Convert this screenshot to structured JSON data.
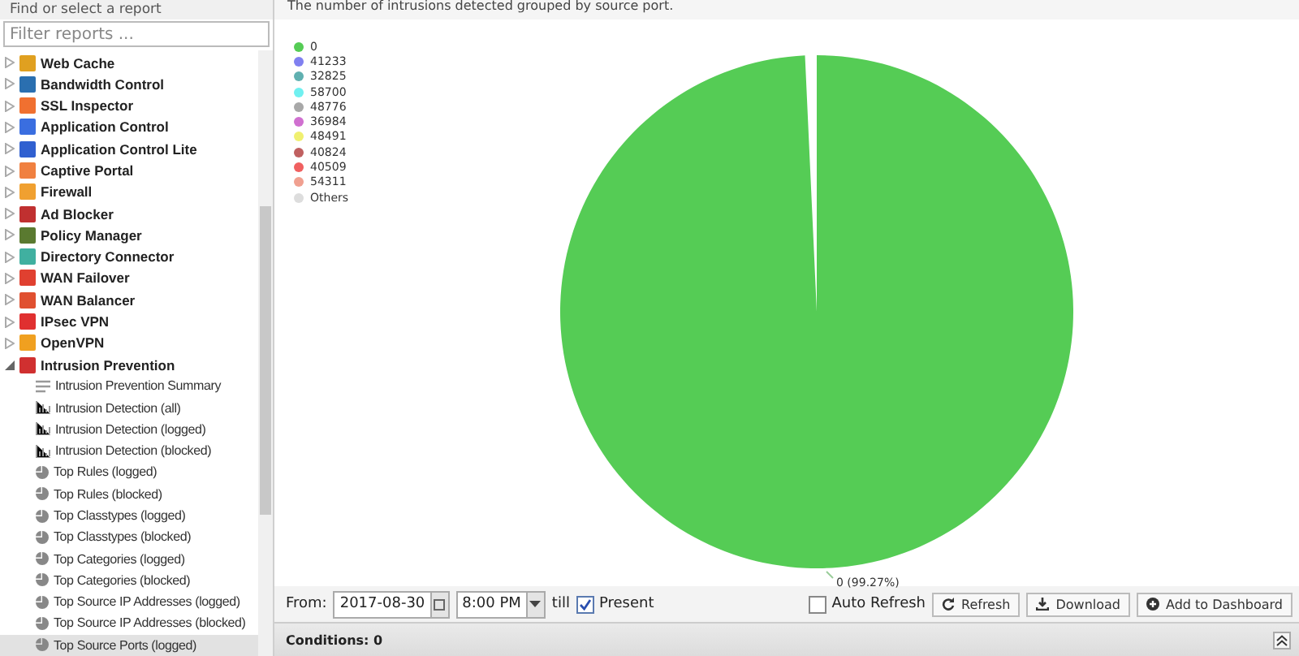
{
  "sidebar": {
    "title": "Find or select a report",
    "filter": {
      "placeholder": "Filter reports ..."
    },
    "items": [
      {
        "label": "Web Cache",
        "color": "#e0a020",
        "expanded": false,
        "selected": false
      },
      {
        "label": "Bandwidth Control",
        "color": "#2a6fb0",
        "expanded": false,
        "selected": false
      },
      {
        "label": "SSL Inspector",
        "color": "#f07030",
        "expanded": false,
        "selected": false
      },
      {
        "label": "Application Control",
        "color": "#3a6ee0",
        "expanded": false,
        "selected": false
      },
      {
        "label": "Application Control Lite",
        "color": "#3060d0",
        "expanded": false,
        "selected": false
      },
      {
        "label": "Captive Portal",
        "color": "#f08040",
        "expanded": false,
        "selected": false
      },
      {
        "label": "Firewall",
        "color": "#f0a030",
        "expanded": false,
        "selected": false
      },
      {
        "label": "Ad Blocker",
        "color": "#c03030",
        "expanded": false,
        "selected": false
      },
      {
        "label": "Policy Manager",
        "color": "#5a7a30",
        "expanded": false,
        "selected": false
      },
      {
        "label": "Directory Connector",
        "color": "#40b0a0",
        "expanded": false,
        "selected": false
      },
      {
        "label": "WAN Failover",
        "color": "#e04030",
        "expanded": false,
        "selected": false
      },
      {
        "label": "WAN Balancer",
        "color": "#e05030",
        "expanded": false,
        "selected": false
      },
      {
        "label": "IPsec VPN",
        "color": "#e03030",
        "expanded": false,
        "selected": false
      },
      {
        "label": "OpenVPN",
        "color": "#f0a020",
        "expanded": false,
        "selected": false
      },
      {
        "label": "Intrusion Prevention",
        "color": "#d03030",
        "expanded": true,
        "selected": false,
        "children": [
          {
            "label": "Intrusion Prevention Summary",
            "kind": "summary",
            "selected": false
          },
          {
            "label": "Intrusion Detection (all)",
            "kind": "timeseries",
            "selected": false
          },
          {
            "label": "Intrusion Detection (logged)",
            "kind": "timeseries",
            "selected": false
          },
          {
            "label": "Intrusion Detection (blocked)",
            "kind": "timeseries",
            "selected": false
          },
          {
            "label": "Top Rules (logged)",
            "kind": "pie",
            "selected": false
          },
          {
            "label": "Top Rules (blocked)",
            "kind": "pie",
            "selected": false
          },
          {
            "label": "Top Classtypes (logged)",
            "kind": "pie",
            "selected": false
          },
          {
            "label": "Top Classtypes (blocked)",
            "kind": "pie",
            "selected": false
          },
          {
            "label": "Top Categories (logged)",
            "kind": "pie",
            "selected": false
          },
          {
            "label": "Top Categories (blocked)",
            "kind": "pie",
            "selected": false
          },
          {
            "label": "Top Source IP Addresses (logged)",
            "kind": "pie",
            "selected": false
          },
          {
            "label": "Top Source IP Addresses (blocked)",
            "kind": "pie",
            "selected": false
          },
          {
            "label": "Top Source Ports (logged)",
            "kind": "pie",
            "selected": true
          }
        ]
      }
    ]
  },
  "report": {
    "description": "The number of intrusions detected grouped by source port.",
    "slice_label": "0 (99.27%)",
    "legend": [
      {
        "label": "0",
        "color": "#55cc55"
      },
      {
        "label": "41233",
        "color": "#8080f0"
      },
      {
        "label": "32825",
        "color": "#60b0b0"
      },
      {
        "label": "58700",
        "color": "#70f0f0"
      },
      {
        "label": "48776",
        "color": "#a8a8a8"
      },
      {
        "label": "36984",
        "color": "#d070d0"
      },
      {
        "label": "48491",
        "color": "#f0f070"
      },
      {
        "label": "40824",
        "color": "#c06060"
      },
      {
        "label": "40509",
        "color": "#f06060"
      },
      {
        "label": "54311",
        "color": "#f0a090"
      },
      {
        "label": "Others",
        "color": "#dddddd"
      }
    ],
    "chart_data": {
      "type": "pie",
      "series": [
        {
          "color": "#55cc55",
          "values": [
            99.27
          ]
        }
      ]
    }
  },
  "toolbar": {
    "from_label": "From:",
    "date": "2017-08-30",
    "time": "8:00 PM",
    "till_label": "till",
    "present": {
      "label": "Present",
      "checked": true
    },
    "auto_refresh": {
      "label": "Auto Refresh",
      "checked": false
    },
    "buttons": [
      {
        "label": "Refresh",
        "kind": "refresh"
      },
      {
        "label": "Download",
        "kind": "download"
      },
      {
        "label": "Add to Dashboard",
        "kind": "add"
      }
    ]
  },
  "conditions": {
    "title": "Conditions: 0"
  }
}
